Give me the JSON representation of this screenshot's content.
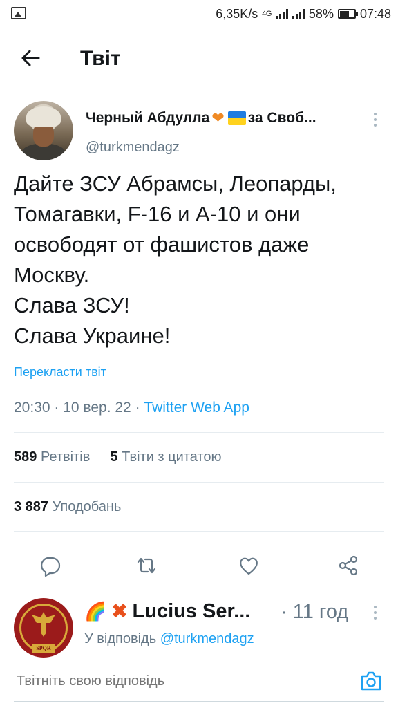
{
  "status_bar": {
    "speed": "6,35K/s",
    "network": "4G",
    "battery": "58%",
    "time": "07:48"
  },
  "header": {
    "title": "Твіт"
  },
  "tweet": {
    "display_name": "Черный Абдулла",
    "display_name_suffix": "за Своб...",
    "handle": "@turkmendagz",
    "text": "Дайте ЗСУ Абрамсы, Леопарды, Томагавки, F-16 и А-10 и они освободят от фашистов даже Москву.\nСлава ЗСУ!\nСлава Украине!",
    "translate_label": "Перекласти твіт",
    "time": "20:30",
    "date": "10 вер. 22",
    "source": "Twitter Web App",
    "retweets_count": "589",
    "retweets_label": "Ретвітів",
    "quotes_count": "5",
    "quotes_label": "Твіти з цитатою",
    "likes_count": "3 887",
    "likes_label": "Уподобань"
  },
  "reply": {
    "display_name": "Lucius Ser...",
    "time": "· 11 год",
    "reply_prefix": "У відповідь",
    "reply_mention": "@turkmendagz",
    "avatar_text": "SPQR"
  },
  "compose": {
    "placeholder": "Твітніть свою відповідь"
  },
  "colors": {
    "accent": "#1da1f2",
    "secondary_text": "#657786",
    "primary_text": "#14171a"
  }
}
